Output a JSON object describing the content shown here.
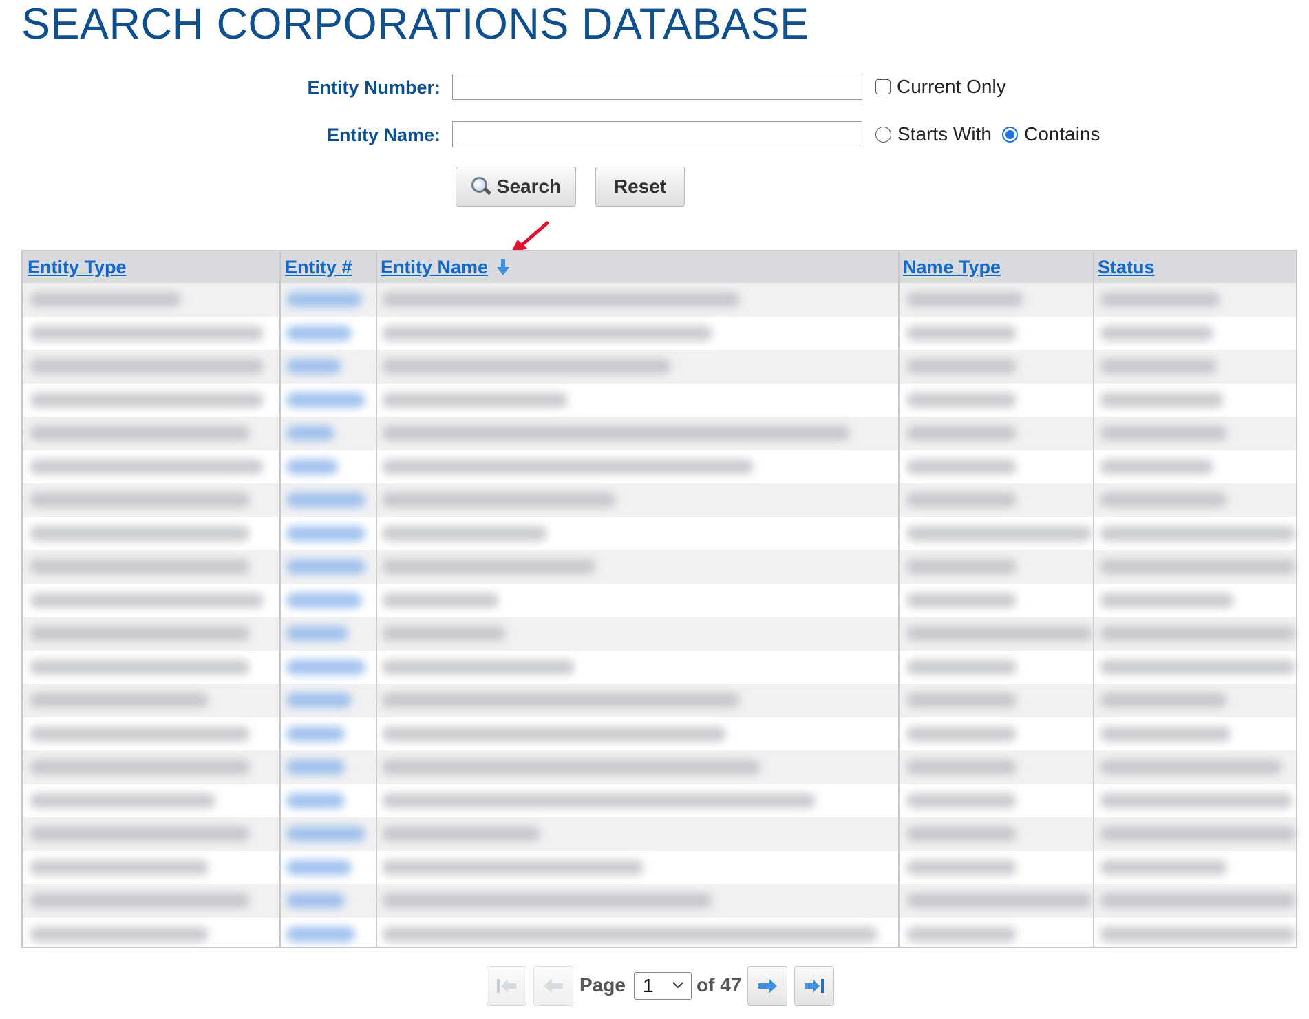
{
  "page": {
    "title": "SEARCH CORPORATIONS DATABASE"
  },
  "form": {
    "entity_number_label": "Entity Number:",
    "entity_number_value": "",
    "current_only_label": "Current Only",
    "current_only_checked": false,
    "entity_name_label": "Entity Name:",
    "entity_name_value": "",
    "match_options": [
      {
        "label": "Starts With",
        "selected": false
      },
      {
        "label": "Contains",
        "selected": true
      }
    ],
    "search_label": "Search",
    "reset_label": "Reset"
  },
  "table": {
    "columns": [
      {
        "label": "Entity Type"
      },
      {
        "label": "Entity #"
      },
      {
        "label": "Entity Name",
        "sorted": "descending"
      },
      {
        "label": "Name Type"
      },
      {
        "label": "Status"
      }
    ],
    "rows_obscured": true,
    "visible_row_count": 20
  },
  "pagination": {
    "page_label": "Page",
    "current_page": "1",
    "of_label": "of 47"
  },
  "icons": {
    "search_button": "magnifier-icon",
    "sort": "sort-down-arrow-icon",
    "first": "first-page-icon",
    "prev": "prev-page-icon",
    "next": "next-page-icon",
    "last": "last-page-icon",
    "annotation": "red-annotation-arrow"
  },
  "colors": {
    "title": "#104f8e",
    "label": "#104f8e",
    "link": "#1368c9",
    "header_bg": "#d9dadd",
    "radio_selected": "#1a73e8",
    "annotation": "#e0102e",
    "pager_arrow": "#3d8fe0"
  }
}
